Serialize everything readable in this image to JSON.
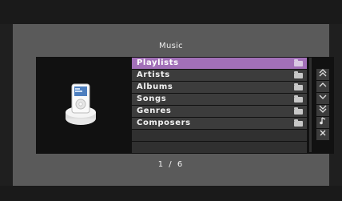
{
  "header": {
    "title": "Music"
  },
  "list": {
    "items": [
      {
        "label": "Playlists",
        "selected": true
      },
      {
        "label": "Artists",
        "selected": false
      },
      {
        "label": "Albums",
        "selected": false
      },
      {
        "label": "Songs",
        "selected": false
      },
      {
        "label": "Genres",
        "selected": false
      },
      {
        "label": "Composers",
        "selected": false
      }
    ],
    "empty_rows": 2
  },
  "controls": [
    {
      "icon": "double-up-icon",
      "glyph": "«"
    },
    {
      "icon": "up-icon",
      "glyph": "^"
    },
    {
      "icon": "down-icon",
      "glyph": "v"
    },
    {
      "icon": "double-down-icon",
      "glyph": "»"
    },
    {
      "icon": "music-note-icon",
      "glyph": "♪"
    },
    {
      "icon": "close-icon",
      "glyph": "×"
    }
  ],
  "pager": {
    "text": "1 / 6"
  },
  "colors": {
    "selected": "#a270b8",
    "panel": "#5a5a5a",
    "inner": "#111111"
  }
}
